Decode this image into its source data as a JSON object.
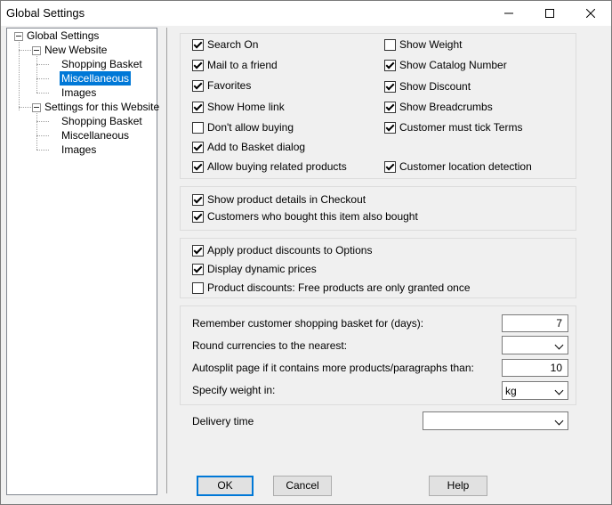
{
  "window": {
    "title": "Global Settings"
  },
  "tree": {
    "root": "Global Settings",
    "new_website": "New Website",
    "new_items": [
      "Shopping Basket",
      "Miscellaneous",
      "Images"
    ],
    "this_website": "Settings for this Website",
    "this_items": [
      "Shopping Basket",
      "Miscellaneous",
      "Images"
    ],
    "selected": "New Website/Miscellaneous"
  },
  "group1": {
    "left": [
      {
        "label": "Search On",
        "checked": true
      },
      {
        "label": "Mail to a friend",
        "checked": true
      },
      {
        "label": "Favorites",
        "checked": true
      },
      {
        "label": "Show Home link",
        "checked": true
      },
      {
        "label": "Don't allow buying",
        "checked": false
      },
      {
        "label": "Add to Basket dialog",
        "checked": true
      },
      {
        "label": "Allow buying related products",
        "checked": true
      }
    ],
    "right": [
      {
        "label": "Show Weight",
        "checked": false
      },
      {
        "label": "Show Catalog Number",
        "checked": true
      },
      {
        "label": "Show Discount",
        "checked": true
      },
      {
        "label": "Show Breadcrumbs",
        "checked": true
      },
      {
        "label": "Customer must tick Terms",
        "checked": true
      },
      {
        "label": "Customer location detection",
        "checked": true
      }
    ]
  },
  "group2": [
    {
      "label": "Show product details in Checkout",
      "checked": true
    },
    {
      "label": "Customers who bought this item also bought",
      "checked": true
    }
  ],
  "group3": [
    {
      "label": "Apply product discounts to Options",
      "checked": true
    },
    {
      "label": "Display dynamic prices",
      "checked": true
    },
    {
      "label": "Product discounts: Free products are only granted once",
      "checked": false
    }
  ],
  "settings": {
    "basket_days_label": "Remember customer shopping basket for (days):",
    "basket_days_value": "7",
    "round_label": "Round currencies to the nearest:",
    "round_value": "",
    "autosplit_label": "Autosplit page if it contains more products/paragraphs than:",
    "autosplit_value": "10",
    "weight_label": "Specify weight in:",
    "weight_value": "kg"
  },
  "delivery": {
    "label": "Delivery time",
    "value": ""
  },
  "buttons": {
    "ok": "OK",
    "cancel": "Cancel",
    "help": "Help"
  }
}
